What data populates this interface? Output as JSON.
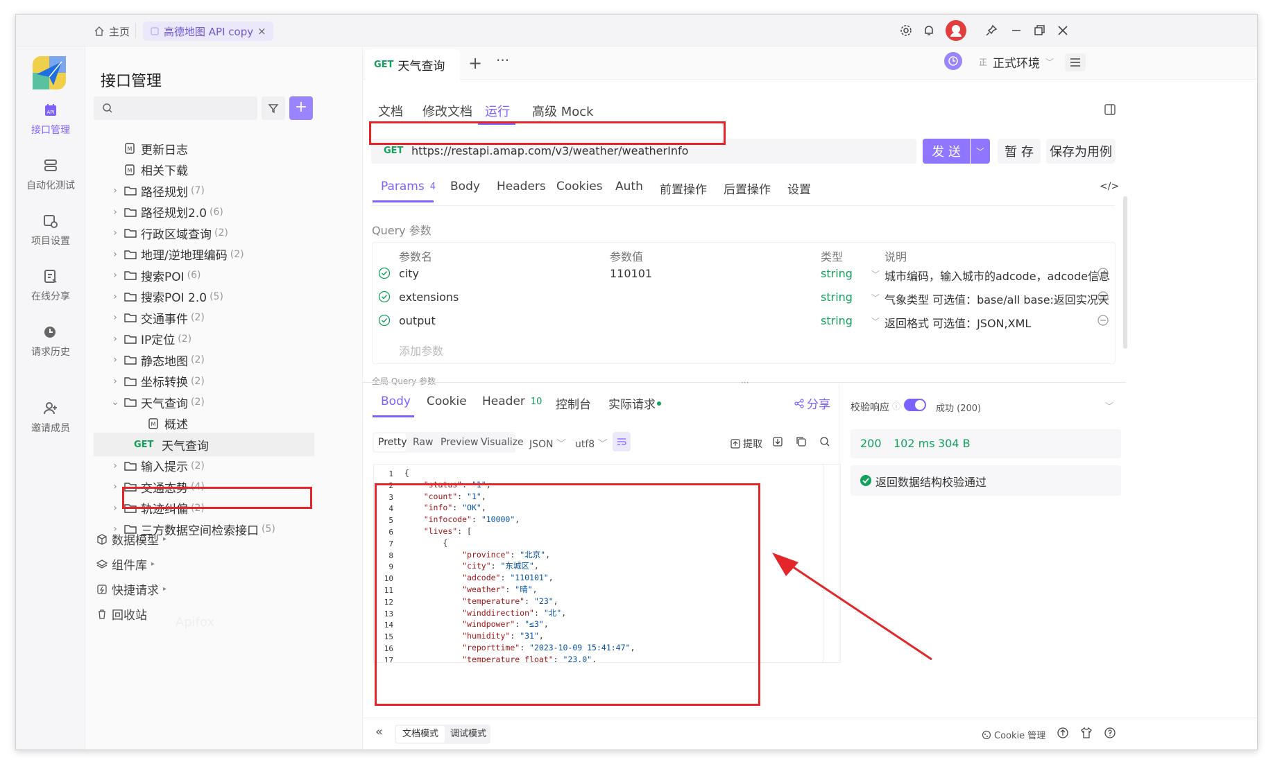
{
  "titlebar": {
    "home_label": "主页",
    "project_tab": "高德地图 API copy"
  },
  "rail": {
    "items": [
      {
        "label": "接口管理",
        "icon": "api-icon"
      },
      {
        "label": "自动化测试",
        "icon": "automation-icon"
      },
      {
        "label": "项目设置",
        "icon": "settings-icon"
      },
      {
        "label": "在线分享",
        "icon": "share-doc-icon"
      },
      {
        "label": "请求历史",
        "icon": "history-icon"
      },
      {
        "label": "邀请成员",
        "icon": "invite-icon"
      }
    ]
  },
  "tree": {
    "title": "接口管理",
    "items": [
      {
        "label": "更新日志",
        "count": "",
        "type": "doc"
      },
      {
        "label": "相关下载",
        "count": "",
        "type": "doc"
      },
      {
        "label": "路径规划",
        "count": "(7)",
        "type": "folder"
      },
      {
        "label": "路径规划2.0",
        "count": "(6)",
        "type": "folder"
      },
      {
        "label": "行政区域查询",
        "count": "(2)",
        "type": "folder"
      },
      {
        "label": "地理/逆地理编码",
        "count": "(2)",
        "type": "folder"
      },
      {
        "label": "搜索POI",
        "count": "(6)",
        "type": "folder"
      },
      {
        "label": "搜索POI 2.0",
        "count": "(5)",
        "type": "folder"
      },
      {
        "label": "交通事件",
        "count": "(2)",
        "type": "folder"
      },
      {
        "label": "IP定位",
        "count": "(2)",
        "type": "folder"
      },
      {
        "label": "静态地图",
        "count": "(2)",
        "type": "folder"
      },
      {
        "label": "坐标转换",
        "count": "(2)",
        "type": "folder"
      },
      {
        "label": "天气查询",
        "count": "(2)",
        "type": "folder-open"
      },
      {
        "label": "概述",
        "count": "",
        "type": "doc-child"
      },
      {
        "label": "天气查询",
        "count": "",
        "type": "get-child",
        "method": "GET"
      },
      {
        "label": "输入提示",
        "count": "(2)",
        "type": "folder"
      },
      {
        "label": "交通态势",
        "count": "(4)",
        "type": "folder"
      },
      {
        "label": "轨迹纠偏",
        "count": "(2)",
        "type": "folder"
      },
      {
        "label": "三方数据空间检索接口",
        "count": "(5)",
        "type": "folder"
      }
    ],
    "bottom": [
      {
        "label": "数据模型",
        "icon": "cube-icon"
      },
      {
        "label": "组件库",
        "icon": "layers-icon"
      },
      {
        "label": "快捷请求",
        "icon": "quick-icon"
      },
      {
        "label": "回收站",
        "icon": "trash-icon"
      }
    ],
    "watermark": "Apifox"
  },
  "header": {
    "tab_method": "GET",
    "tab_title": "天气查询",
    "env_label": "正式环境",
    "env_badge": "正"
  },
  "subtabs": [
    "文档",
    "修改文档",
    "运行",
    "高级 Mock"
  ],
  "request": {
    "method": "GET",
    "url": "https://restapi.amap.com/v3/weather/weatherInfo",
    "send": "发 送",
    "save": "暂 存",
    "save_case": "保存为用例"
  },
  "req_tabs": {
    "params": "Params",
    "params_count": "4",
    "others": [
      "Body",
      "Headers",
      "Cookies",
      "Auth",
      "前置操作",
      "后置操作",
      "设置"
    ]
  },
  "query": {
    "title": "Query 参数",
    "headers": [
      "参数名",
      "参数值",
      "类型",
      "说明"
    ],
    "rows": [
      {
        "name": "city",
        "value": "110101",
        "type": "string",
        "desc": "城市编码，输入城市的adcode，adcode信息"
      },
      {
        "name": "extensions",
        "value": "",
        "type": "string",
        "desc": "气象类型  可选值：base/all  base:返回实况天"
      },
      {
        "name": "output",
        "value": "",
        "type": "string",
        "desc": "返回格式  可选值：JSON,XML"
      }
    ],
    "add_placeholder": "添加参数",
    "global_label": "全局 Query 参数"
  },
  "response": {
    "tabs": [
      "Body",
      "Cookie",
      "Header",
      "控制台",
      "实际请求"
    ],
    "header_count": "10",
    "share": "分享",
    "view_modes": [
      "Pretty",
      "Raw",
      "Preview",
      "Visualize"
    ],
    "format": "JSON",
    "encoding": "utf8",
    "extract": "提取",
    "code_lines": [
      "{",
      "    \"status\": \"1\",",
      "    \"count\": \"1\",",
      "    \"info\": \"OK\",",
      "    \"infocode\": \"10000\",",
      "    \"lives\": [",
      "        {",
      "            \"province\": \"北京\",",
      "            \"city\": \"东城区\",",
      "            \"adcode\": \"110101\",",
      "            \"weather\": \"晴\",",
      "            \"temperature\": \"23\",",
      "            \"winddirection\": \"北\",",
      "            \"windpower\": \"≤3\",",
      "            \"humidity\": \"31\",",
      "            \"reporttime\": \"2023-10-09 15:41:47\",",
      "            \"temperature_float\": \"23.0\","
    ]
  },
  "validate": {
    "label": "校验响应",
    "result": "成功 (200)",
    "status": "200",
    "time": "102 ms",
    "size": "304 B",
    "message": "返回数据结构校验通过"
  },
  "footer": {
    "doc_mode": "文档模式",
    "debug_mode": "调试模式",
    "cookie_mgmt": "Cookie 管理"
  },
  "colors": {
    "accent": "#7b61ff",
    "get": "#12a05b",
    "annotation": "#e4262a"
  }
}
